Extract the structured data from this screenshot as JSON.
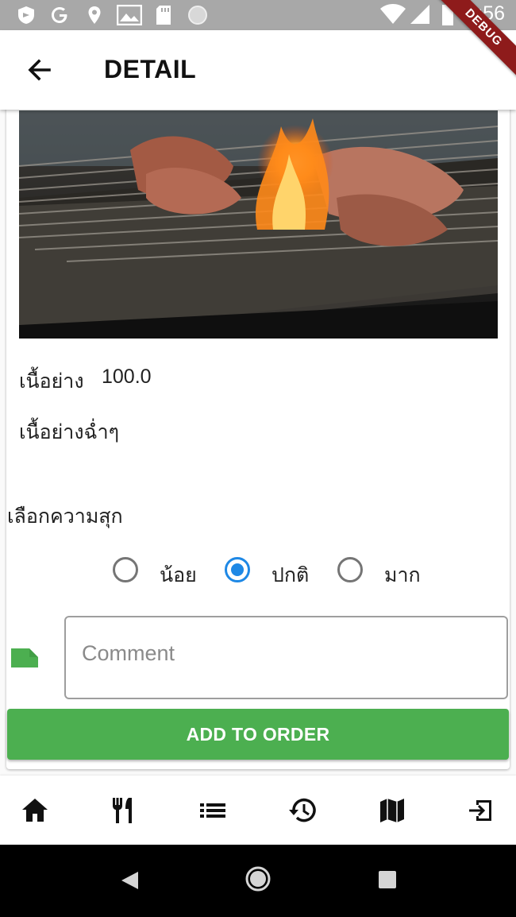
{
  "status_bar": {
    "time": "8:56",
    "left_icons": [
      "shield-icon",
      "google-icon",
      "location-icon",
      "photo-icon",
      "sd-card-icon",
      "circle-icon"
    ],
    "right_icons": [
      "wifi-icon",
      "signal-icon",
      "battery-icon"
    ]
  },
  "debug_banner": "DEBUG",
  "app_bar": {
    "back_icon": "arrow-back-icon",
    "title": "DETAIL"
  },
  "item": {
    "name": "เนื้อย่าง",
    "price": "100.0",
    "description": "เนื้อย่างฉ่ำๆ"
  },
  "happiness": {
    "label": "เลือกความสุก",
    "options": [
      {
        "label": "น้อย",
        "selected": false
      },
      {
        "label": "ปกติ",
        "selected": true
      },
      {
        "label": "มาก",
        "selected": false
      }
    ]
  },
  "comment": {
    "icon": "note-icon",
    "value": "",
    "placeholder": "Comment"
  },
  "actions": {
    "add_to_order": "ADD TO ORDER"
  },
  "bottom_nav": {
    "items": [
      "home-icon",
      "restaurant-icon",
      "list-icon",
      "history-icon",
      "map-icon",
      "exit-icon"
    ]
  },
  "system_nav": [
    "back-triangle-icon",
    "home-circle-icon",
    "recents-square-icon"
  ],
  "colors": {
    "accent_green": "#4caf50",
    "radio_selected": "#1e88e5",
    "status_bar": "#a8a8a8",
    "debug_ribbon": "#8e1b1b"
  }
}
